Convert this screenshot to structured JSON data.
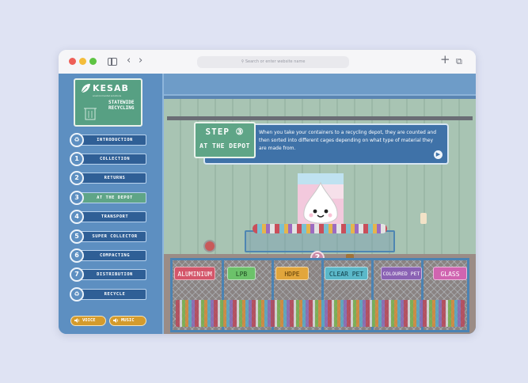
{
  "browser": {
    "url_placeholder": "Search or enter website name"
  },
  "logo": {
    "name": "KESAB",
    "subtitle": "environmental solutions",
    "tagline": "STATEWIDE\nRECYCLING"
  },
  "nav": [
    {
      "badge": "♻",
      "label": "INTRODUCTION"
    },
    {
      "badge": "1",
      "label": "COLLECTION"
    },
    {
      "badge": "2",
      "label": "RETURNS"
    },
    {
      "badge": "3",
      "label": "AT THE DEPOT"
    },
    {
      "badge": "4",
      "label": "TRANSPORT"
    },
    {
      "badge": "5",
      "label": "SUPER COLLECTOR"
    },
    {
      "badge": "6",
      "label": "COMPACTING"
    },
    {
      "badge": "7",
      "label": "DISTRIBUTION"
    },
    {
      "badge": "♻",
      "label": "RECYCLE"
    }
  ],
  "audio": {
    "voice": "VOICE",
    "music": "MUSIC"
  },
  "banner": {
    "step": "STEP ③",
    "subtitle": "AT THE DEPOT",
    "text": "When you take your containers to a recycling depot, they are counted and then sorted into different cages depending on what type of material they are made from."
  },
  "cages": [
    {
      "label": "ALUMINIUM",
      "color": "#d4566a"
    },
    {
      "label": "LPB",
      "color": "#6cc26a"
    },
    {
      "label": "HDPE",
      "color": "#e2a63c"
    },
    {
      "label": "CLEAR PET",
      "color": "#5bb8c9"
    },
    {
      "label": "COLOURED PET",
      "color": "#8a62b4"
    },
    {
      "label": "GLASS",
      "color": "#d064b0"
    }
  ],
  "question_mark": "?"
}
